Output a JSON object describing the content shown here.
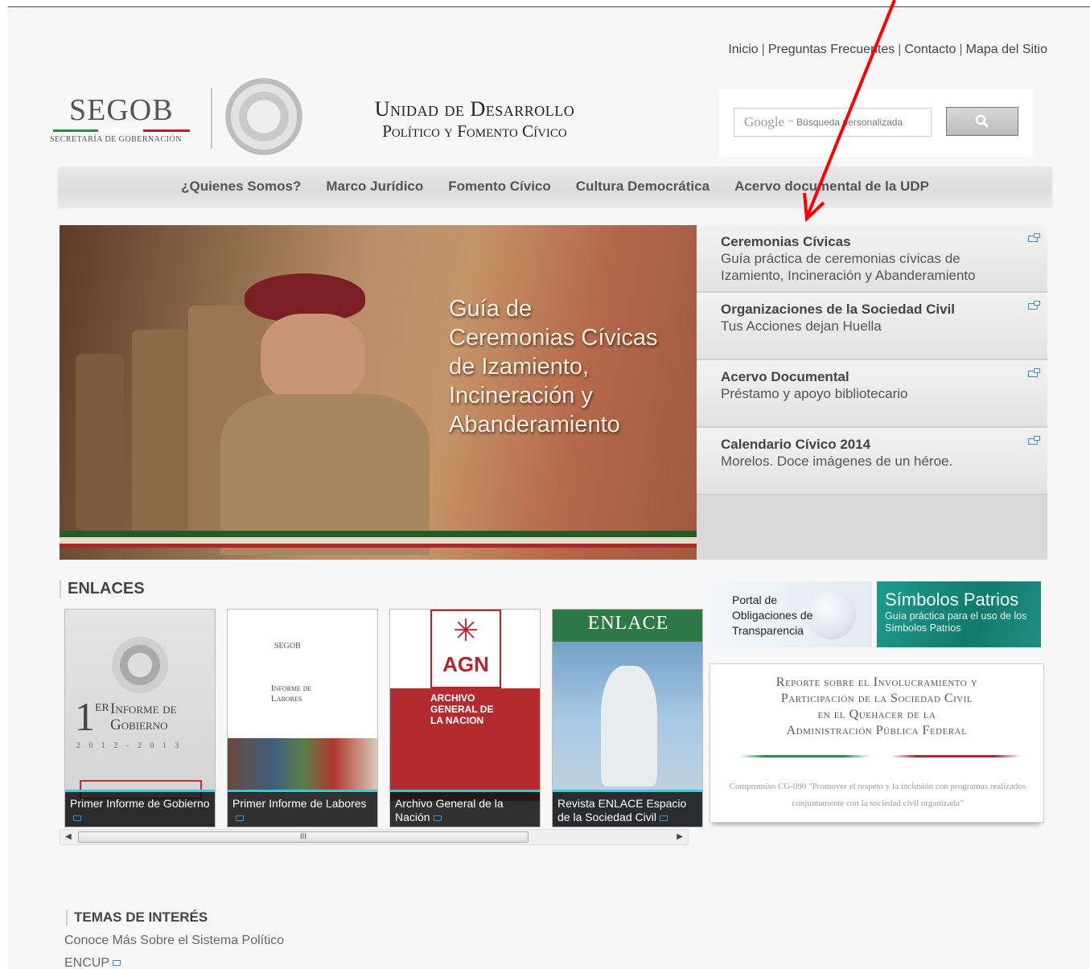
{
  "top_links": [
    "Inicio",
    "Preguntas Frecuentes",
    "Contacto",
    "Mapa del Sitio"
  ],
  "top_links_separator": "|",
  "logo": {
    "name": "SEGOB",
    "subtitle": "SECRETARÍA DE GOBERNACIÓN",
    "seal": "escudo-nacional-icon"
  },
  "unit_title": {
    "line1": "Unidad de Desarrollo",
    "line2": "Político y Fomento Cívico"
  },
  "search": {
    "brand": "Google",
    "placeholder": "Búsqueda personalizada",
    "button_icon": "search-icon"
  },
  "nav": [
    "¿Quienes Somos?",
    "Marco Jurídico",
    "Fomento Cívico",
    "Cultura Democrática",
    "Acervo documental de la UDP"
  ],
  "hero": {
    "text": "Guía de Ceremonias Cívicas de Izamiento, Incineración y Abanderamiento",
    "lines": [
      "Guía de",
      "Ceremonias Cívicas",
      "de Izamiento,",
      "Incineración y",
      "Abanderamiento"
    ]
  },
  "side_items": [
    {
      "title": "Ceremonias Cívicas",
      "desc": "Guía práctica de ceremonias cívicas de Izamiento, Incineración y Abanderamiento"
    },
    {
      "title": "Organizaciones de la Sociedad Civil",
      "desc": "Tus Acciones dejan Huella"
    },
    {
      "title": "Acervo Documental",
      "desc": "Préstamo y apoyo bibliotecario"
    },
    {
      "title": "Calendario Cívico 2014",
      "desc": "Morelos. Doce imágenes de un héroe."
    }
  ],
  "enlaces": {
    "title": "ENLACES",
    "cards": [
      {
        "caption": "Primer Informe de Gobierno",
        "cover_top": "1",
        "cover_sup": "ER",
        "cover_title": "Informe de Gobierno",
        "cover_years": "2 0 1 2 - 2 0 1 3"
      },
      {
        "caption": "Primer Informe de Labores",
        "cover_brand": "SEGOB",
        "cover_title": "Informe de Labores"
      },
      {
        "caption": "Archivo General de la Nación",
        "cover_logo": "AGN",
        "cover_sub": "ARCHIVO GENERAL DE LA NACION"
      },
      {
        "caption": "Revista ENLACE Espacio de la Sociedad Civil",
        "cover_title": "ENLACE"
      }
    ],
    "scroll_thumb_label": "III"
  },
  "portal_banner": {
    "line1": "Portal de",
    "line2": "Obligaciones de",
    "line3": "Transparencia"
  },
  "simbolos_banner": {
    "title": "Símbolos Patrios",
    "subtitle": "Guía práctica para el uso de los Símbolos Patrios"
  },
  "report": {
    "title": "Reporte sobre el Involucramiento y Participación de la Sociedad Civil en el Quehacer de la Administración Pública Federal",
    "lines": [
      "Reporte sobre el Involucramiento y",
      "Participación de la Sociedad Civil",
      "en el Quehacer de la",
      "Administración Pública Federal"
    ],
    "subtitle": "Compromiso CG-090 \"Promover el respeto y la inclusión con programas realizados conjuntamente con la sociedad civil organizada\""
  },
  "temas": {
    "title": "TEMAS DE INTERÉS",
    "line1": "Conoce Más Sobre el Sistema Político",
    "line2": "ENCUP"
  },
  "colors": {
    "nav_text": "#555555",
    "green": "#1f5d2a",
    "red": "#b12727",
    "teal": "#1c9b8d",
    "link_icon": "#3b8fd0",
    "annotation_arrow": "#ff0000"
  }
}
